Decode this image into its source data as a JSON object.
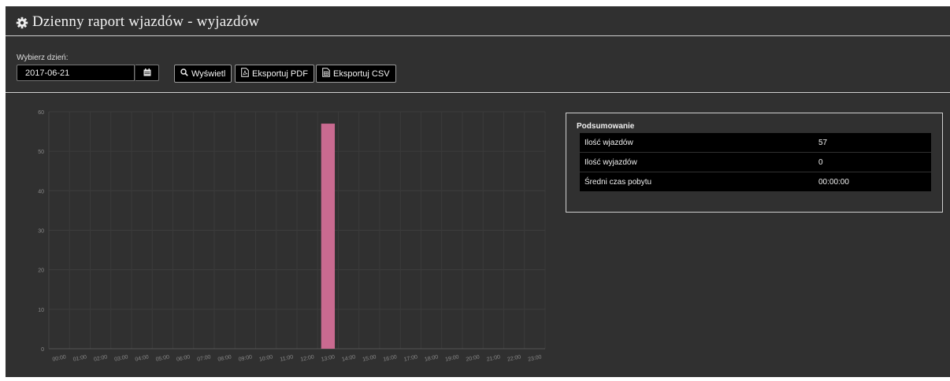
{
  "header": {
    "title": "Dzienny raport wjazdów - wyjazdów",
    "icon": "gear-icon"
  },
  "toolbar": {
    "date_label": "Wybierz dzień:",
    "date_value": "2017-06-21",
    "calendar_icon": "calendar-icon",
    "show_label": "Wyświetl",
    "pdf_label": "Eksportuj PDF",
    "csv_label": "Eksportuj CSV"
  },
  "summary": {
    "title": "Podsumowanie",
    "rows": [
      {
        "label": "Ilość wjazdów",
        "value": "57"
      },
      {
        "label": "Ilość wyjazdów",
        "value": "0"
      },
      {
        "label": "Średni czas pobytu",
        "value": "00:00:00"
      }
    ]
  },
  "chart_data": {
    "type": "bar",
    "categories": [
      "00:00",
      "01:00",
      "02:00",
      "03:00",
      "04:00",
      "05:00",
      "06:00",
      "07:00",
      "08:00",
      "09:00",
      "10:00",
      "11:00",
      "12:00",
      "13:00",
      "14:00",
      "15:00",
      "16:00",
      "17:00",
      "18:00",
      "19:00",
      "20:00",
      "21:00",
      "22:00",
      "23:00"
    ],
    "series": [
      {
        "values": [
          0,
          0,
          0,
          0,
          0,
          0,
          0,
          0,
          0,
          0,
          0,
          0,
          0,
          57,
          0,
          0,
          0,
          0,
          0,
          0,
          0,
          0,
          0,
          0
        ],
        "color": "#c96a90"
      }
    ],
    "ylim": [
      0,
      60
    ],
    "yticks": [
      0,
      10,
      20,
      30,
      40,
      50,
      60
    ],
    "grid": true,
    "legend": "none",
    "title": "",
    "xlabel": "",
    "ylabel": ""
  }
}
